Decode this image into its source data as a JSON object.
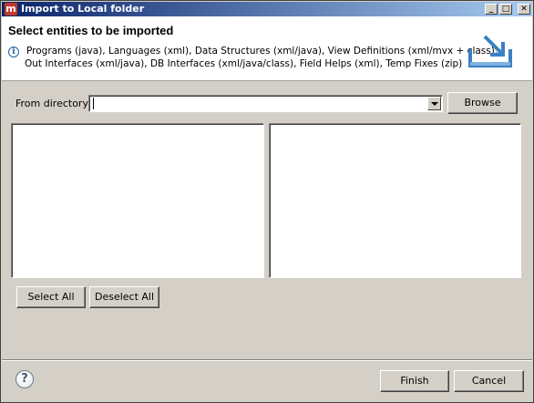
{
  "window": {
    "app_icon": "m",
    "title": "Import to Local folder",
    "controls": {
      "minimize_glyph": "_",
      "maximize_glyph": "□",
      "close_glyph": "✕"
    }
  },
  "header": {
    "heading": "Select entities to be imported",
    "info_icon": "i",
    "description_line1": "Programs (java), Languages (xml), Data Structures (xml/java), View Definitions (xml/mvx + class),",
    "description_line2": "Out Interfaces (xml/java), DB Interfaces (xml/java/class), Field Helps (xml), Temp Fixes (zip)",
    "graphic": "import-tray-icon"
  },
  "directory": {
    "label": "From directory:",
    "value": "",
    "browse_label": "Browse"
  },
  "lists": {
    "left_items": [],
    "right_items": []
  },
  "selection": {
    "select_all_label": "Select All",
    "deselect_all_label": "Deselect All"
  },
  "footer": {
    "help_glyph": "?",
    "finish_label": "Finish",
    "cancel_label": "Cancel"
  },
  "colors": {
    "titlebar_start": "#0a246a",
    "titlebar_end": "#a6caf0",
    "dialog_face": "#d4d0c8",
    "info_blue": "#1f5fa8",
    "graphic_blue": "#3b7fc4"
  }
}
